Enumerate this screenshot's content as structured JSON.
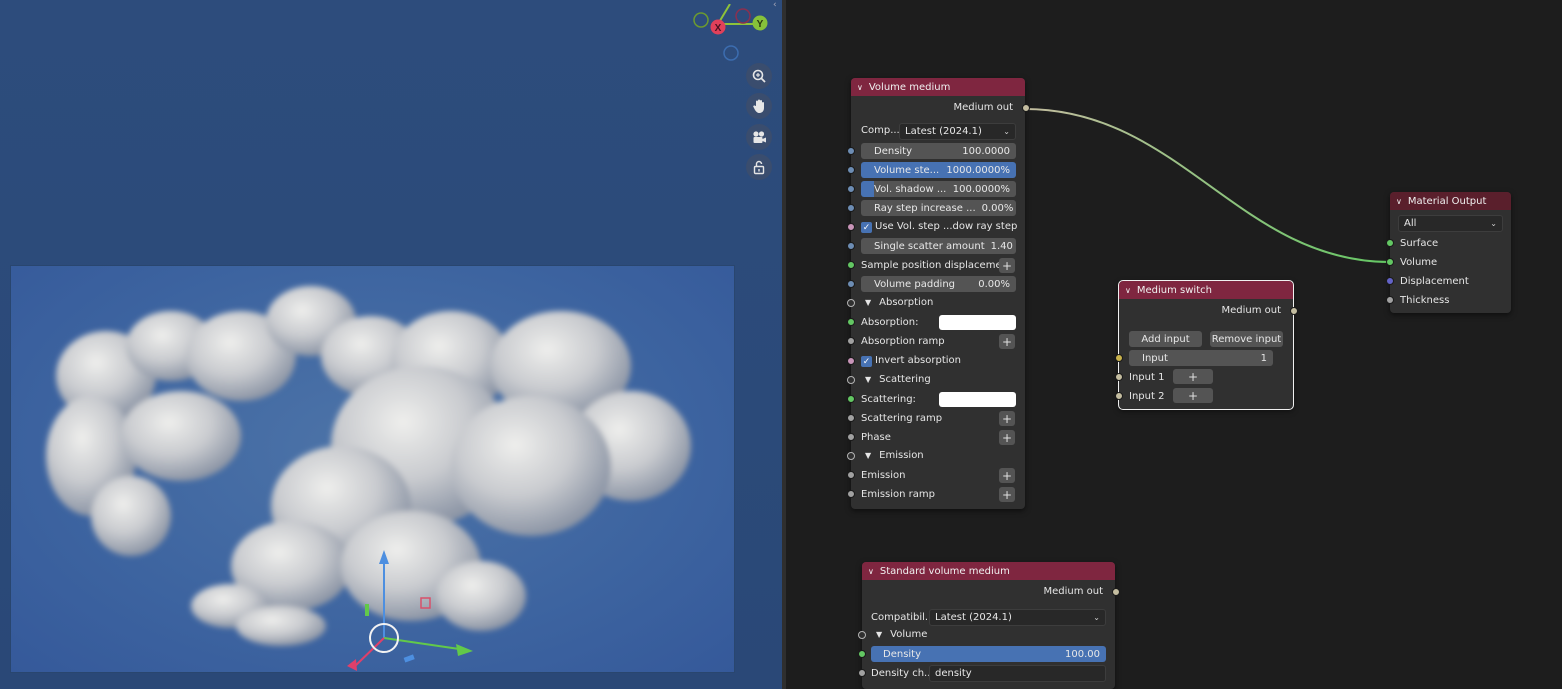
{
  "viewport": {
    "gizmo": {
      "x": "X",
      "y": "Y"
    },
    "tools": [
      "zoom-icon",
      "pan-hand-icon",
      "camera-icon",
      "lock-icon"
    ]
  },
  "volume_medium": {
    "title": "Volume medium",
    "output": "Medium out",
    "comp_label": "Comp...",
    "comp_value": "Latest (2024.1)",
    "density_label": "Density",
    "density_value": "100.0000",
    "volstep_label": "Volume ste...",
    "volstep_value": "1000.0000%",
    "volshadow_label": "Vol. shadow ...",
    "volshadow_value": "100.0000%",
    "raystep_label": "Ray step increase ...",
    "raystep_value": "0.00%",
    "usevol_label": "Use Vol. step ...dow ray step",
    "scatter_label": "Single scatter amount",
    "scatter_value": "1.40",
    "sample_label": "Sample position displacement",
    "padding_label": "Volume padding",
    "padding_value": "0.00%",
    "absorption_section": "Absorption",
    "absorption_label": "Absorption:",
    "absorption_ramp": "Absorption ramp",
    "invert_label": "Invert absorption",
    "scattering_section": "Scattering",
    "scattering_label": "Scattering:",
    "scattering_ramp": "Scattering ramp",
    "phase_label": "Phase",
    "emission_section": "Emission",
    "emission_label": "Emission",
    "emission_ramp": "Emission ramp"
  },
  "medium_switch": {
    "title": "Medium switch",
    "output": "Medium out",
    "add_input": "Add input",
    "remove_input": "Remove input",
    "input_label": "Input",
    "input_value": "1",
    "input1": "Input 1",
    "input2": "Input 2"
  },
  "material_output": {
    "title": "Material Output",
    "target": "All",
    "surface": "Surface",
    "volume": "Volume",
    "displacement": "Displacement",
    "thickness": "Thickness"
  },
  "standard_volume": {
    "title": "Standard volume medium",
    "output": "Medium out",
    "compat_label": "Compatibil...",
    "compat_value": "Latest (2024.1)",
    "volume_section": "Volume",
    "density_label": "Density",
    "density_value": "100.00",
    "density_ch_label": "Density ch...",
    "density_ch_value": "density"
  },
  "colors": {
    "node_header": "#7f2640",
    "active_field": "#4772b3",
    "link_green": "#63c763"
  }
}
